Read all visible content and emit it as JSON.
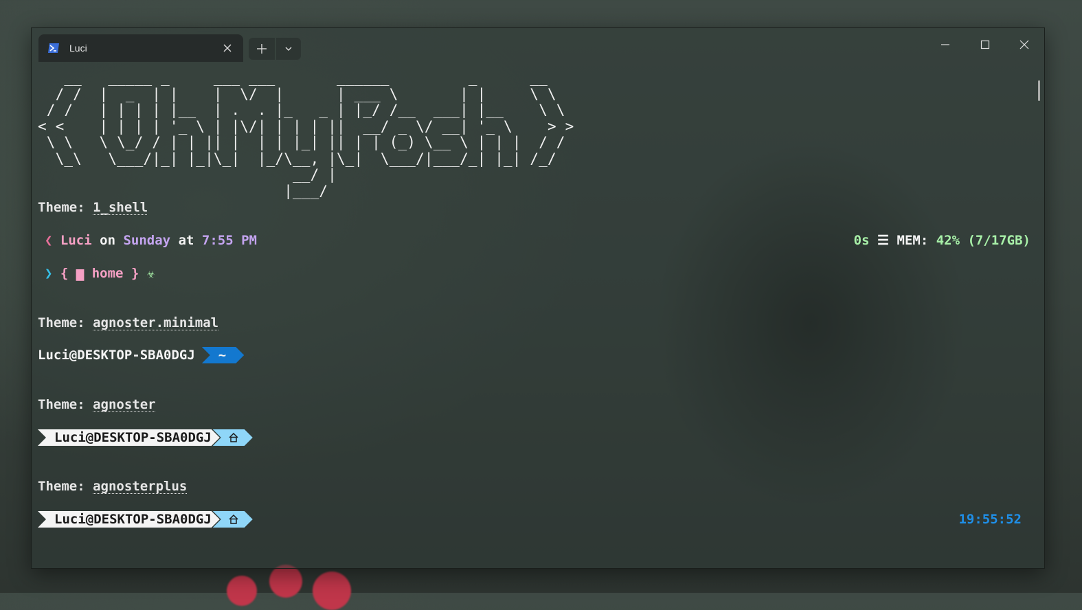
{
  "tab": {
    "title": "Luci",
    "icon": "powershell-icon"
  },
  "ascii_art": [
    "   __   _____ _     ___ ___       ______         _      __",
    "  / /  |  _  | |    |  \\/  |      | ___ \\       | |     \\ \\",
    " / /   | | | | |__  | .  . |_   _ | |_/ /__  ___| |__    \\ \\",
    "< <    | | | | '_ \\ | |\\/| | | | ||  __/ _ \\/ __| '_ \\    > >",
    " \\ \\   \\ \\_/ / | | || |  | | |_| || | | (_) \\__ \\ | | |  / /",
    "  \\_\\   \\___/|_| |_|\\_|  |_/\\__, |\\_|  \\___/|___/_| |_| /_/",
    "                             __/ |",
    "                            |___/"
  ],
  "themes": [
    {
      "label": "Theme: ",
      "name": "1_shell",
      "prompt1": {
        "user": "Luci",
        "on": "on",
        "day": "Sunday",
        "at": "at",
        "time": "7:55 PM"
      },
      "right": {
        "duration": "0s",
        "mem_label": "MEM:",
        "mem_value": "42% (7/17GB)"
      },
      "prompt2": {
        "open": "{",
        "folder": "home",
        "close": "}"
      }
    },
    {
      "label": "Theme: ",
      "name": "agnoster.minimal",
      "prompt": "Luci@DESKTOP-SBA0DGJ",
      "path": "~"
    },
    {
      "label": "Theme: ",
      "name": "agnoster",
      "prompt": "Luci@DESKTOP-SBA0DGJ"
    },
    {
      "label": "Theme: ",
      "name": "agnosterplus",
      "prompt": "Luci@DESKTOP-SBA0DGJ",
      "time": "19:55:52"
    }
  ],
  "colors": {
    "pink": "#f5a0c4",
    "purple": "#c4a4f0",
    "green": "#a8f0a8",
    "cyan": "#35c0e8",
    "agnoster_blue": "#1378cf",
    "agnoster_light_blue": "#8fd6f8",
    "time_blue": "#1f8fe8"
  }
}
